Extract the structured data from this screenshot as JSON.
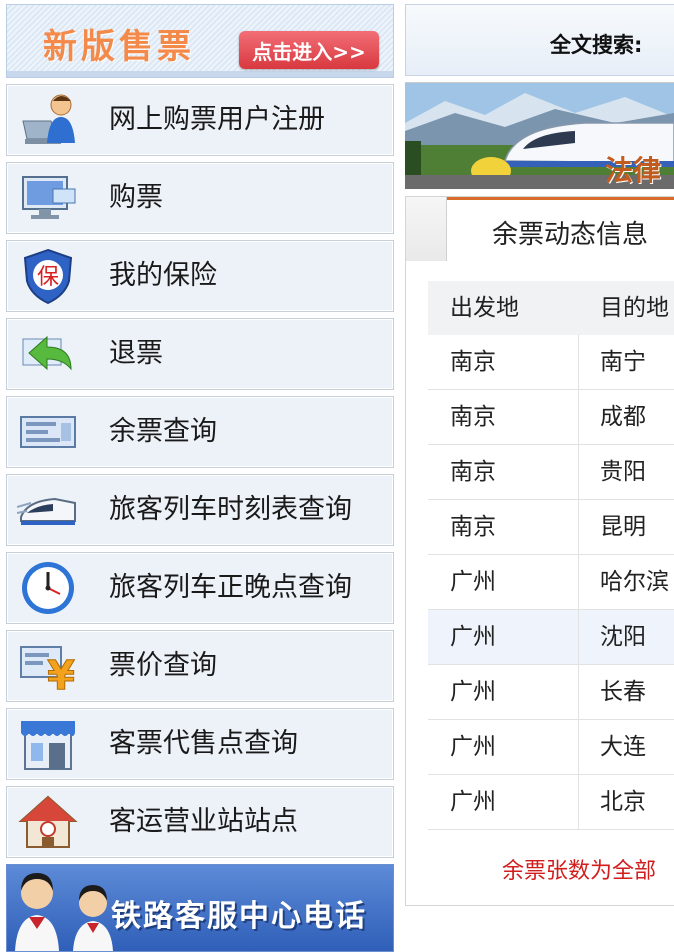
{
  "promo": {
    "title": "新版售票",
    "button_label": "点击进入>>"
  },
  "menu": [
    {
      "label": "网上购票用户注册",
      "icon": "user-register-icon"
    },
    {
      "label": "购票",
      "icon": "computer-ticket-icon"
    },
    {
      "label": "我的保险",
      "icon": "insurance-shield-icon"
    },
    {
      "label": "退票",
      "icon": "refund-arrow-icon"
    },
    {
      "label": "余票查询",
      "icon": "ticket-query-icon"
    },
    {
      "label": "旅客列车时刻表查询",
      "icon": "train-icon"
    },
    {
      "label": "旅客列车正晚点查询",
      "icon": "clock-icon"
    },
    {
      "label": "票价查询",
      "icon": "yuan-price-icon"
    },
    {
      "label": "客票代售点查询",
      "icon": "shop-icon"
    },
    {
      "label": "客运营业站站点",
      "icon": "station-house-icon"
    }
  ],
  "banner": {
    "text": "铁路客服中心电话"
  },
  "search": {
    "label": "全文搜索:"
  },
  "photo": {
    "overlay_text": "法律"
  },
  "ticket_panel": {
    "tab_label": "余票动态信息",
    "columns": [
      "出发地",
      "目的地"
    ],
    "rows": [
      [
        "南京",
        "南宁"
      ],
      [
        "南京",
        "成都"
      ],
      [
        "南京",
        "贵阳"
      ],
      [
        "南京",
        "昆明"
      ],
      [
        "广州",
        "哈尔滨"
      ],
      [
        "广州",
        "沈阳"
      ],
      [
        "广州",
        "长春"
      ],
      [
        "广州",
        "大连"
      ],
      [
        "广州",
        "北京"
      ]
    ],
    "highlighted_row": 5,
    "note": "余票张数为全部"
  },
  "colors": {
    "promo_title": "#f48a4a",
    "promo_button": "#d9383f",
    "menu_bg": "#edf2f9",
    "tab_accent": "#d96b2b",
    "note_red": "#d21d1d"
  }
}
